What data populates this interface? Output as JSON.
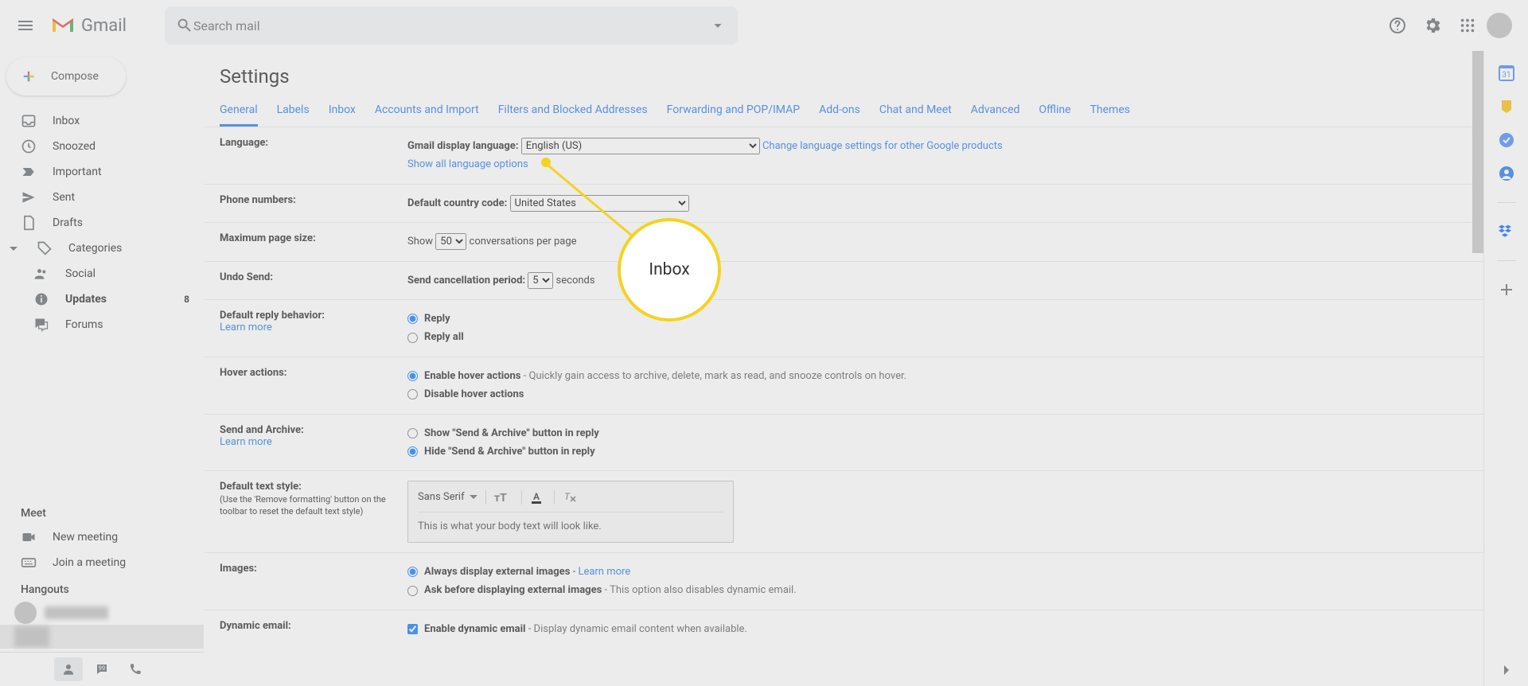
{
  "header": {
    "app_name": "Gmail",
    "search_placeholder": "Search mail"
  },
  "compose_label": "Compose",
  "nav": {
    "inbox": "Inbox",
    "snoozed": "Snoozed",
    "important": "Important",
    "sent": "Sent",
    "drafts": "Drafts",
    "categories": "Categories",
    "social": "Social",
    "updates": "Updates",
    "updates_count": "8",
    "forums": "Forums"
  },
  "meet": {
    "header": "Meet",
    "new": "New meeting",
    "join": "Join a meeting"
  },
  "hangouts_header": "Hangouts",
  "settings_title": "Settings",
  "tabs": [
    "General",
    "Labels",
    "Inbox",
    "Accounts and Import",
    "Filters and Blocked Addresses",
    "Forwarding and POP/IMAP",
    "Add-ons",
    "Chat and Meet",
    "Advanced",
    "Offline",
    "Themes"
  ],
  "callout": "Inbox",
  "rows": {
    "language": {
      "label": "Language:",
      "field": "Gmail display language:",
      "select": "English (US)",
      "change": "Change language settings for other Google products",
      "show": "Show all language options"
    },
    "phone": {
      "label": "Phone numbers:",
      "field": "Default country code:",
      "select": "United States"
    },
    "pagesize": {
      "label": "Maximum page size:",
      "prefix": "Show",
      "count": "50",
      "suffix": "conversations per page"
    },
    "undo": {
      "label": "Undo Send:",
      "field": "Send cancellation period:",
      "val": "5",
      "unit": "seconds"
    },
    "reply": {
      "label": "Default reply behavior:",
      "learn": "Learn more",
      "a": "Reply",
      "b": "Reply all"
    },
    "hover": {
      "label": "Hover actions:",
      "a": "Enable hover actions",
      "ahint": " - Quickly gain access to archive, delete, mark as read, and snooze controls on hover.",
      "b": "Disable hover actions"
    },
    "sendarchive": {
      "label": "Send and Archive:",
      "learn": "Learn more",
      "a": "Show \"Send & Archive\" button in reply",
      "b": "Hide \"Send & Archive\" button in reply"
    },
    "textstyle": {
      "label": "Default text style:",
      "hint": "(Use the 'Remove formatting' button on the toolbar to reset the default text style)",
      "font": "Sans Serif",
      "preview": "This is what your body text will look like."
    },
    "images": {
      "label": "Images:",
      "a": "Always display external images",
      "alearn": "Learn more",
      "b": "Ask before displaying external images",
      "bhint": " - This option also disables dynamic email."
    },
    "dynamic": {
      "label": "Dynamic email:",
      "a": "Enable dynamic email",
      "ahint": " - Display dynamic email content when available."
    }
  }
}
